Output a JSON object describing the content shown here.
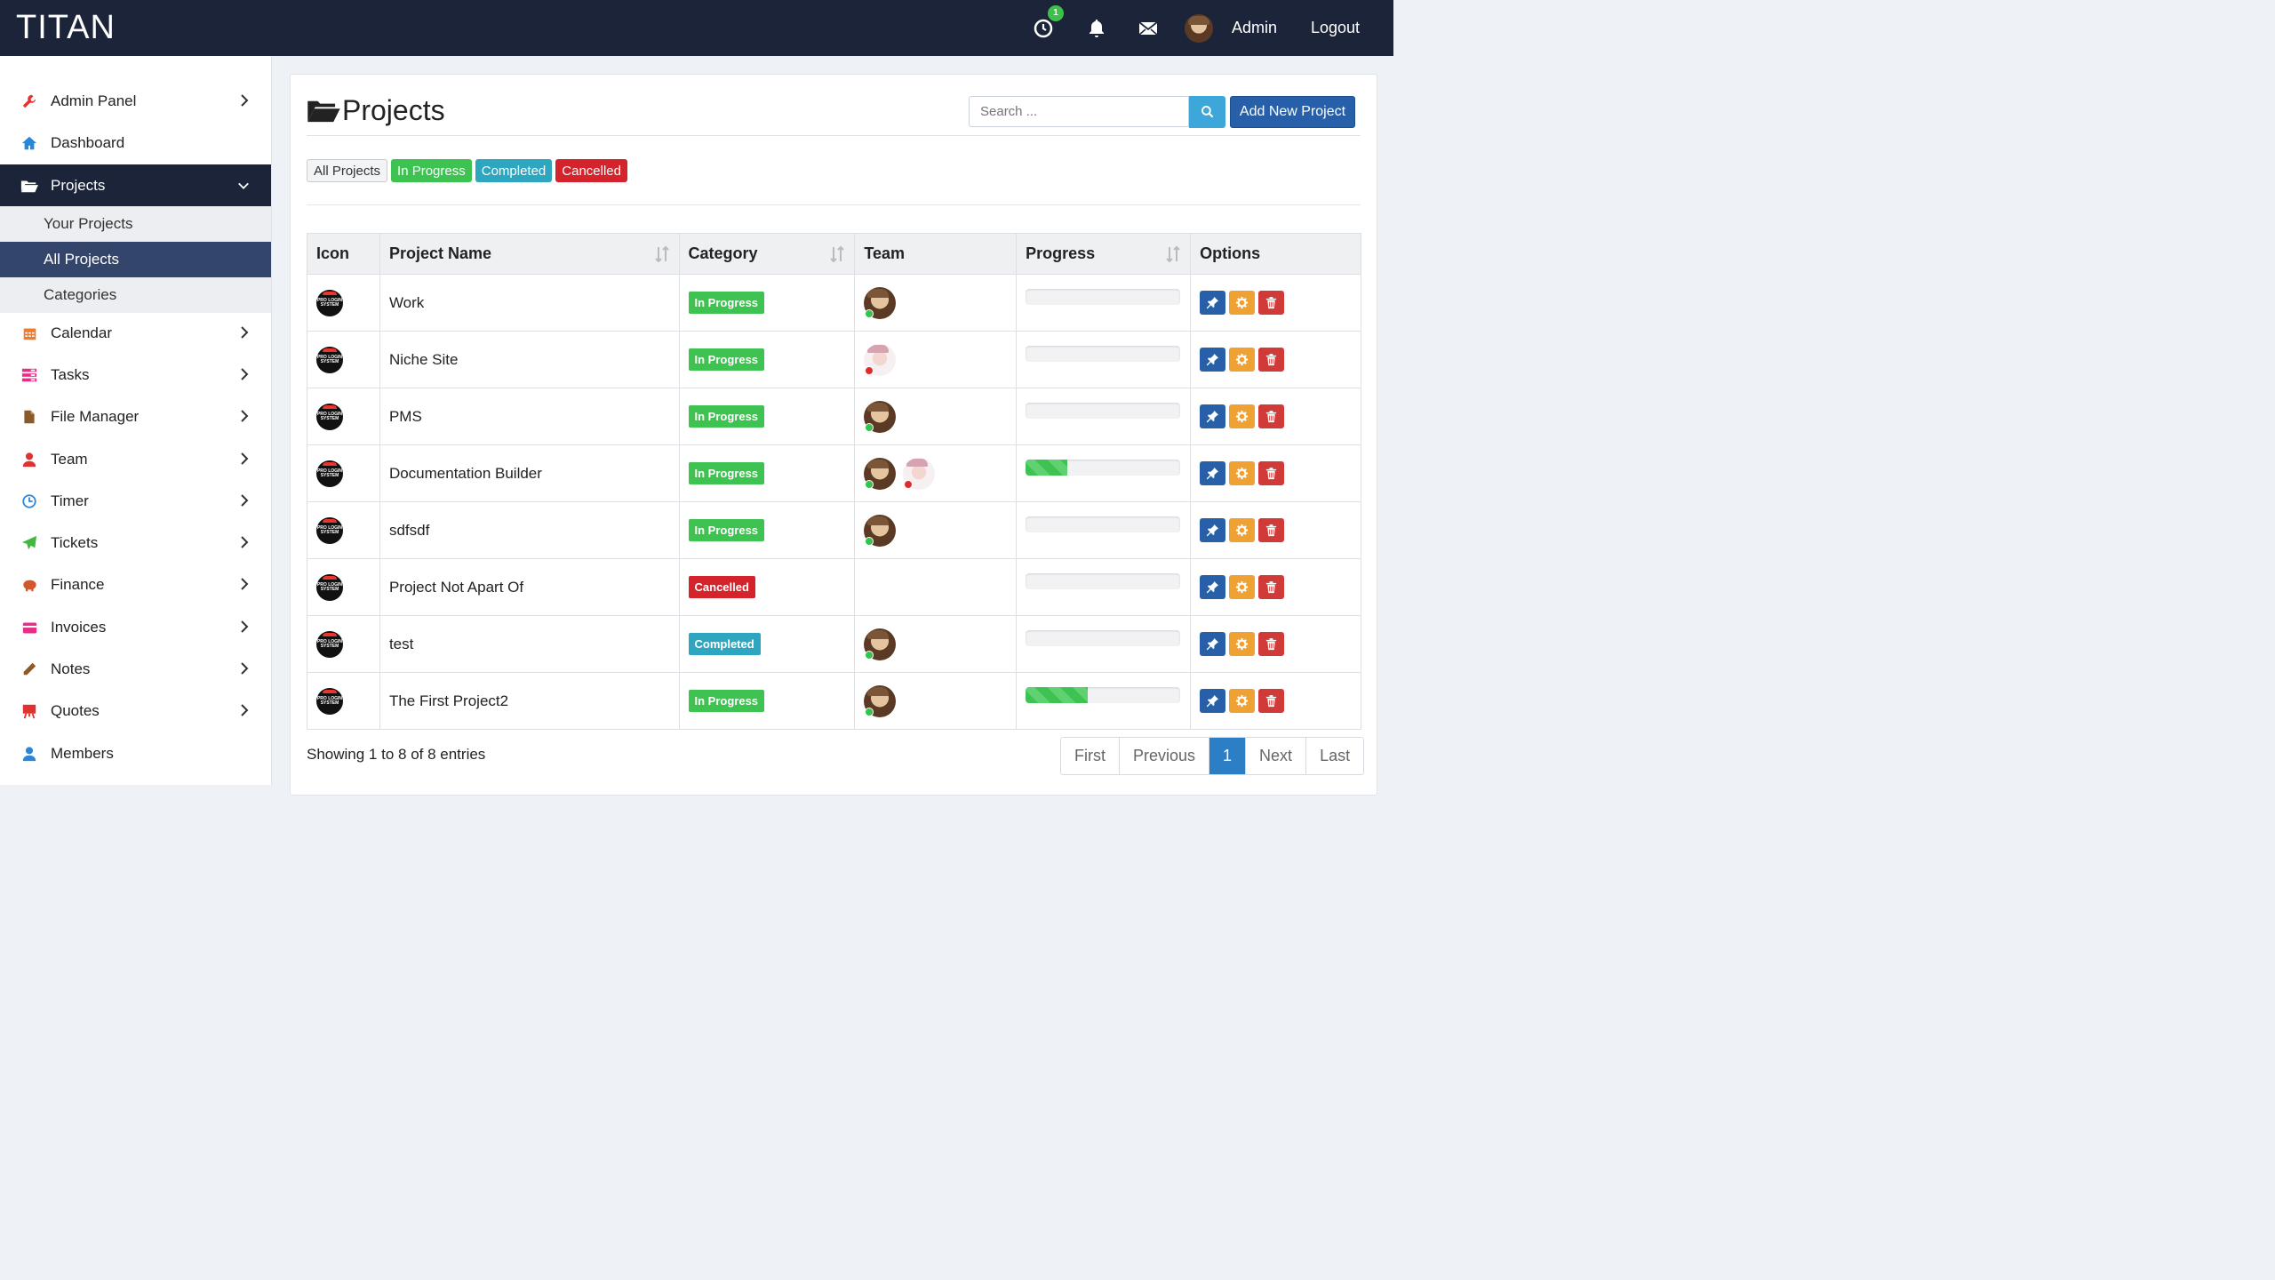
{
  "brand": "TITAN",
  "topbar": {
    "timer_badge": "1",
    "user_name": "Admin",
    "logout": "Logout",
    "colors": {
      "background": "#1b2438",
      "badge": "#3cc14a"
    }
  },
  "sidebar": {
    "items": [
      {
        "label": "Admin Panel",
        "icon": "wrench-icon",
        "color": "#e0322f"
      },
      {
        "label": "Dashboard",
        "icon": "home-icon",
        "color": "#2c86d6"
      },
      {
        "label": "Projects",
        "icon": "folder-open-icon",
        "color": "#ffffff"
      },
      {
        "label": "Calendar",
        "icon": "calendar-icon",
        "color": "#f07b2f"
      },
      {
        "label": "Tasks",
        "icon": "tasks-icon",
        "color": "#e92b8a"
      },
      {
        "label": "File Manager",
        "icon": "file-icon",
        "color": "#8b5a2b"
      },
      {
        "label": "Team",
        "icon": "user-icon",
        "color": "#e0322f"
      },
      {
        "label": "Timer",
        "icon": "clock-icon",
        "color": "#2c86d6"
      },
      {
        "label": "Tickets",
        "icon": "paper-plane-icon",
        "color": "#46b73e"
      },
      {
        "label": "Finance",
        "icon": "piggy-icon",
        "color": "#d4572a"
      },
      {
        "label": "Invoices",
        "icon": "credit-card-icon",
        "color": "#e92b8a"
      },
      {
        "label": "Notes",
        "icon": "pencil-icon",
        "color": "#8b5a2b"
      },
      {
        "label": "Quotes",
        "icon": "easel-icon",
        "color": "#e0322f"
      },
      {
        "label": "Members",
        "icon": "user-icon",
        "color": "#2c86d6"
      }
    ],
    "sub_items": [
      {
        "label": "Your Projects"
      },
      {
        "label": "All Projects"
      },
      {
        "label": "Categories"
      }
    ]
  },
  "main": {
    "title": "Projects",
    "search_placeholder": "Search ...",
    "add_button": "Add New Project",
    "filters": {
      "all": "All Projects",
      "in_progress": "In Progress",
      "completed": "Completed",
      "cancelled": "Cancelled"
    },
    "columns": [
      "Icon",
      "Project Name",
      "Category",
      "Team",
      "Progress",
      "Options"
    ],
    "icon_text": "PRO LOGIN SYSTEM",
    "rows": [
      {
        "name": "Work",
        "category": "In Progress",
        "cat_type": "prog",
        "team": [
          {
            "type": "man",
            "status": "on"
          }
        ],
        "progress": 0
      },
      {
        "name": "Niche Site",
        "category": "In Progress",
        "cat_type": "prog",
        "team": [
          {
            "type": "girl",
            "status": "off"
          }
        ],
        "progress": 0
      },
      {
        "name": "PMS",
        "category": "In Progress",
        "cat_type": "prog",
        "team": [
          {
            "type": "man",
            "status": "on"
          }
        ],
        "progress": 0
      },
      {
        "name": "Documentation Builder",
        "category": "In Progress",
        "cat_type": "prog",
        "team": [
          {
            "type": "man",
            "status": "on"
          },
          {
            "type": "girl",
            "status": "off"
          }
        ],
        "progress": 27
      },
      {
        "name": "sdfsdf",
        "category": "In Progress",
        "cat_type": "prog",
        "team": [
          {
            "type": "man",
            "status": "on"
          }
        ],
        "progress": 0
      },
      {
        "name": "Project Not Apart Of",
        "category": "Cancelled",
        "cat_type": "canc",
        "team": [],
        "progress": 0
      },
      {
        "name": "test",
        "category": "Completed",
        "cat_type": "comp",
        "team": [
          {
            "type": "man",
            "status": "on"
          }
        ],
        "progress": 0
      },
      {
        "name": "The First Project2",
        "category": "In Progress",
        "cat_type": "prog",
        "team": [
          {
            "type": "man",
            "status": "on"
          }
        ],
        "progress": 40
      }
    ],
    "showing": "Showing 1 to 8 of 8 entries",
    "pagination": {
      "first": "First",
      "previous": "Previous",
      "current": "1",
      "next": "Next",
      "last": "Last"
    }
  }
}
